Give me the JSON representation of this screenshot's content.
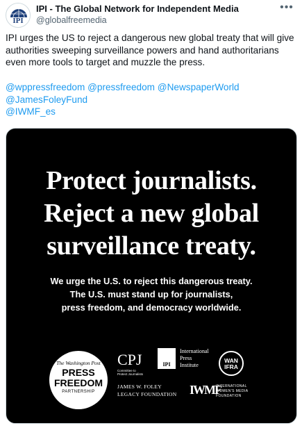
{
  "tweet": {
    "author_name": "IPI - The Global Network for Independent Media",
    "author_handle": "@globalfreemedia",
    "avatar_text": "IPI",
    "more_icon": "ellipsis-icon",
    "text": "IPI urges the US to reject a dangerous new global treaty that will give authorities sweeping surveillance powers and hand authoritarians even more tools to target and muzzle the press.",
    "mentions": [
      "@wppressfreedom",
      "@pressfreedom",
      "@NewspaperWorld",
      "@JamesFoleyFund",
      "@IWMF_es"
    ],
    "accent_color": "#1d9bf0"
  },
  "media": {
    "headline": [
      "Protect journalists.",
      "Reject a new global",
      "surveillance treaty."
    ],
    "subtext": [
      "We urge the U.S. to reject this dangerous treaty.",
      "The U.S. must stand up for journalists,",
      "press freedom, and democracy worldwide."
    ],
    "logos": {
      "wapo": {
        "paper": "The Washington Post",
        "line1": "PRESS",
        "line2": "FREEDOM",
        "line3": "PARTNERSHIP"
      },
      "cpj": {
        "mark": "CPJ",
        "sub": "Committee to Protect Journalists"
      },
      "ipi": {
        "mark": "IPI",
        "name": [
          "International",
          "Press",
          "Institute"
        ]
      },
      "wan": {
        "line1": "WAN",
        "line2": "IFRA"
      },
      "foley": {
        "line1": "JAMES W. FOLEY",
        "line2": "LEGACY FOUNDATION"
      },
      "iwmf": {
        "mark": "IWMF",
        "name": [
          "INTERNATIONAL",
          "WOMEN'S MEDIA",
          "FOUNDATION"
        ]
      }
    }
  }
}
